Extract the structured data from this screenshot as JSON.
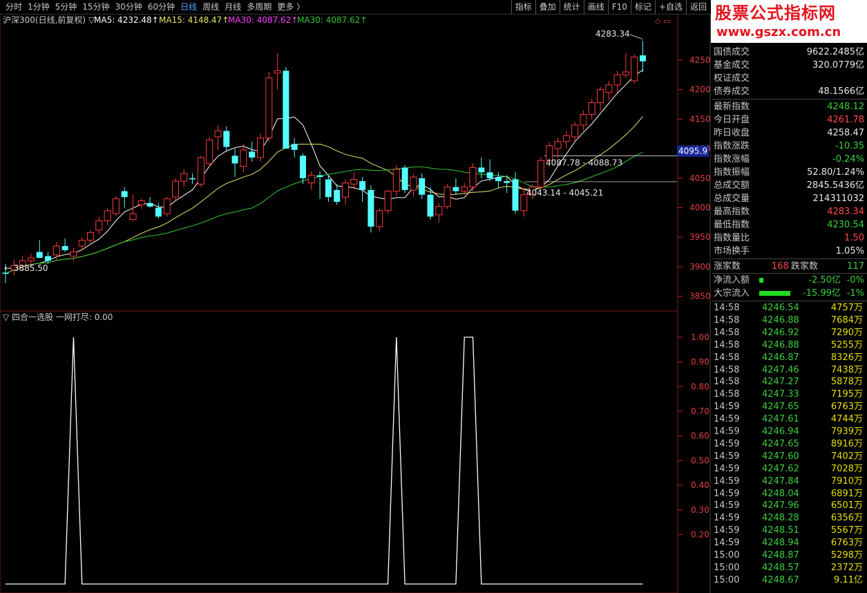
{
  "toolbar": {
    "periods": [
      "分时",
      "1分钟",
      "5分钟",
      "15分钟",
      "30分钟",
      "60分钟",
      "日线",
      "周线",
      "月线",
      "多周期",
      "更多 〉"
    ],
    "active_period": "日线",
    "right_buttons": [
      "指标",
      "叠加",
      "统计",
      "画线",
      "F10",
      "标记",
      "+自选",
      "返回"
    ]
  },
  "watermark": {
    "title": "股票公式指标网",
    "url": "www.gszx.com.cn"
  },
  "colors": {
    "up": "#ff3b3b",
    "down": "#54ffff",
    "ma5": "#ffffff",
    "ma15": "#e8e86a",
    "ma30a": "#ff40ff",
    "ma30b": "#36c936",
    "grid": "#7a1d1d"
  },
  "main_chart": {
    "legend": {
      "name": "沪深300(日线,前复权) ▽",
      "ma5": "MA5: 4232.48↑",
      "ma15": "MA15: 4148.47↑",
      "ma30a": "MA30: 4087.62↑",
      "ma30b": "MA30: 4087.62↑"
    },
    "ymin": 3825,
    "ymax": 4305,
    "ticks": [
      "4250",
      "4200",
      "4150",
      "4100",
      "4050",
      "4000",
      "3950",
      "3900",
      "3850"
    ],
    "current_price_label": "4095.9",
    "annotations": {
      "high": "4283.34",
      "low": "3885.50",
      "range1": "4087.78 - 4088.73",
      "range2": "4043.14 - 4045.21"
    },
    "ohlc": [
      [
        3890,
        3905,
        3872,
        3888
      ],
      [
        3895,
        3912,
        3885,
        3902
      ],
      [
        3902,
        3918,
        3893,
        3910
      ],
      [
        3910,
        3922,
        3900,
        3915
      ],
      [
        3925,
        3945,
        3918,
        3915
      ],
      [
        3918,
        3925,
        3905,
        3910
      ],
      [
        3920,
        3942,
        3912,
        3935
      ],
      [
        3935,
        3948,
        3925,
        3928
      ],
      [
        3918,
        3932,
        3910,
        3925
      ],
      [
        3935,
        3950,
        3928,
        3945
      ],
      [
        3945,
        3962,
        3938,
        3958
      ],
      [
        3962,
        3985,
        3955,
        3978
      ],
      [
        3978,
        4000,
        3970,
        3995
      ],
      [
        3990,
        4020,
        3985,
        4015
      ],
      [
        4028,
        4035,
        4000,
        4018
      ],
      [
        3980,
        4022,
        3978,
        3990
      ],
      [
        4005,
        4015,
        3998,
        4012
      ],
      [
        4008,
        4018,
        4000,
        4002
      ],
      [
        4000,
        4008,
        3982,
        3985
      ],
      [
        3990,
        4018,
        3985,
        4015
      ],
      [
        4018,
        4050,
        4012,
        4045
      ],
      [
        4045,
        4065,
        4035,
        4058
      ],
      [
        4050,
        4058,
        4040,
        4048
      ],
      [
        4040,
        4088,
        4035,
        4085
      ],
      [
        4075,
        4120,
        4070,
        4115
      ],
      [
        4120,
        4140,
        4098,
        4130
      ],
      [
        4130,
        4138,
        4095,
        4103
      ],
      [
        4088,
        4100,
        4052,
        4075
      ],
      [
        4070,
        4108,
        4060,
        4098
      ],
      [
        4095,
        4112,
        4078,
        4085
      ],
      [
        4085,
        4125,
        4078,
        4118
      ],
      [
        4118,
        4230,
        4112,
        4220
      ],
      [
        4228,
        4262,
        4200,
        4232
      ],
      [
        4232,
        4238,
        4105,
        4100
      ],
      [
        4108,
        4118,
        4085,
        4098
      ],
      [
        4088,
        4092,
        4040,
        4050
      ],
      [
        4042,
        4062,
        4030,
        4055
      ],
      [
        4055,
        4062,
        4015,
        4052
      ],
      [
        4048,
        4055,
        4010,
        4018
      ],
      [
        4030,
        4040,
        4005,
        4010
      ],
      [
        4018,
        4048,
        4005,
        4042
      ],
      [
        4040,
        4060,
        4030,
        4048
      ],
      [
        4045,
        4052,
        4010,
        4030
      ],
      [
        4030,
        4038,
        3958,
        3968
      ],
      [
        3968,
        3998,
        3960,
        3995
      ],
      [
        3995,
        4030,
        3990,
        4028
      ],
      [
        4028,
        4072,
        4020,
        4065
      ],
      [
        4068,
        4072,
        4025,
        4030
      ],
      [
        4030,
        4058,
        4018,
        4052
      ],
      [
        4050,
        4058,
        4015,
        4022
      ],
      [
        4022,
        4035,
        3980,
        3985
      ],
      [
        3988,
        4008,
        3975,
        4002
      ],
      [
        4002,
        4040,
        3998,
        4035
      ],
      [
        4035,
        4050,
        4022,
        4028
      ],
      [
        4028,
        4042,
        4022,
        4035
      ],
      [
        4035,
        4075,
        4028,
        4068
      ],
      [
        4068,
        4085,
        4050,
        4060
      ],
      [
        4060,
        4082,
        4045,
        4050
      ],
      [
        4052,
        4060,
        4032,
        4045
      ],
      [
        4045,
        4055,
        4025,
        4042
      ],
      [
        4048,
        4060,
        3990,
        3995
      ],
      [
        3995,
        4035,
        3985,
        4022
      ],
      [
        4022,
        4040,
        4015,
        4035
      ],
      [
        4035,
        4085,
        4030,
        4080
      ],
      [
        4080,
        4110,
        4070,
        4105
      ],
      [
        4100,
        4118,
        4085,
        4112
      ],
      [
        4112,
        4130,
        4100,
        4122
      ],
      [
        4120,
        4145,
        4110,
        4140
      ],
      [
        4140,
        4165,
        4130,
        4158
      ],
      [
        4158,
        4185,
        4150,
        4178
      ],
      [
        4178,
        4205,
        4165,
        4200
      ],
      [
        4195,
        4215,
        4182,
        4208
      ],
      [
        4208,
        4232,
        4195,
        4225
      ],
      [
        4225,
        4262,
        4220,
        4230
      ],
      [
        4215,
        4260,
        4210,
        4255
      ],
      [
        4258,
        4283,
        4230,
        4248
      ]
    ]
  },
  "sub_chart": {
    "legend": "▽ 四合一选股 一网打尽: 0.00",
    "ymin": 0,
    "ymax": 1.05,
    "ticks": [
      "1.00",
      "0.90",
      "0.80",
      "0.70",
      "0.60",
      "0.50",
      "0.40",
      "0.30",
      "0.20"
    ],
    "spikes": [
      [
        8,
        1.0
      ],
      [
        46,
        1.0
      ],
      [
        54,
        1.0
      ],
      [
        55,
        1.0
      ]
    ]
  },
  "quote_panel": {
    "top_rows": [
      {
        "label": "国债成交",
        "value": "9622.2485亿",
        "color": "white"
      },
      {
        "label": "基金成交",
        "value": "320.0779亿",
        "color": "white"
      },
      {
        "label": "权证成交",
        "value": "",
        "color": "white"
      },
      {
        "label": "债券成交",
        "value": "48.1566亿",
        "color": "white"
      }
    ],
    "index_rows": [
      {
        "label": "最新指数",
        "value": "4248.12",
        "color": "green"
      },
      {
        "label": "今日开盘",
        "value": "4261.78",
        "color": "red"
      },
      {
        "label": "昨日收盘",
        "value": "4258.47",
        "color": "white"
      },
      {
        "label": "指数涨跌",
        "value": "-10.35",
        "color": "green"
      },
      {
        "label": "指数涨幅",
        "value": "-0.24%",
        "color": "green"
      },
      {
        "label": "指数振幅",
        "value": "52.80/1.24%",
        "color": "white"
      },
      {
        "label": "总成交额",
        "value": "2845.5436亿",
        "color": "white"
      },
      {
        "label": "总成交量",
        "value": "214311032",
        "color": "white"
      },
      {
        "label": "最高指数",
        "value": "4283.34",
        "color": "red"
      },
      {
        "label": "最低指数",
        "value": "4230.54",
        "color": "green"
      },
      {
        "label": "指数量比",
        "value": "1.50",
        "color": "red"
      },
      {
        "label": "市场换手",
        "value": "1.05%",
        "color": "white"
      }
    ],
    "breadth": {
      "up_label": "涨家数",
      "up": "168",
      "down_label": "跌家数",
      "down": "117"
    },
    "flows": [
      {
        "label": "净流入额",
        "value": "-2.50亿",
        "pct": "-0%",
        "bar": 0.05
      },
      {
        "label": "大宗流入",
        "value": "-15.99亿",
        "pct": "-1%",
        "bar": 0.5
      }
    ],
    "ticks": [
      [
        "14:58",
        "4246.54",
        "4757万"
      ],
      [
        "14:58",
        "4246.88",
        "7684万"
      ],
      [
        "14:58",
        "4246.92",
        "7290万"
      ],
      [
        "14:58",
        "4246.88",
        "5255万"
      ],
      [
        "14:58",
        "4246.87",
        "8326万"
      ],
      [
        "14:58",
        "4247.46",
        "7438万"
      ],
      [
        "14:58",
        "4247.27",
        "5878万"
      ],
      [
        "14:58",
        "4247.33",
        "7195万"
      ],
      [
        "14:59",
        "4247.65",
        "6763万"
      ],
      [
        "14:59",
        "4247.61",
        "4744万"
      ],
      [
        "14:59",
        "4246.94",
        "7939万"
      ],
      [
        "14:59",
        "4247.65",
        "8916万"
      ],
      [
        "14:59",
        "4247.60",
        "7402万"
      ],
      [
        "14:59",
        "4247.62",
        "7028万"
      ],
      [
        "14:59",
        "4247.84",
        "7910万"
      ],
      [
        "14:59",
        "4248.04",
        "6891万"
      ],
      [
        "14:59",
        "4247.96",
        "6501万"
      ],
      [
        "14:59",
        "4248.28",
        "6356万"
      ],
      [
        "14:59",
        "4248.51",
        "5567万"
      ],
      [
        "14:59",
        "4248.94",
        "6763万"
      ],
      [
        "15:00",
        "4248.87",
        "5298万"
      ],
      [
        "15:00",
        "4248.57",
        "2372万"
      ],
      [
        "15:00",
        "4248.67",
        "9.11亿"
      ]
    ]
  }
}
